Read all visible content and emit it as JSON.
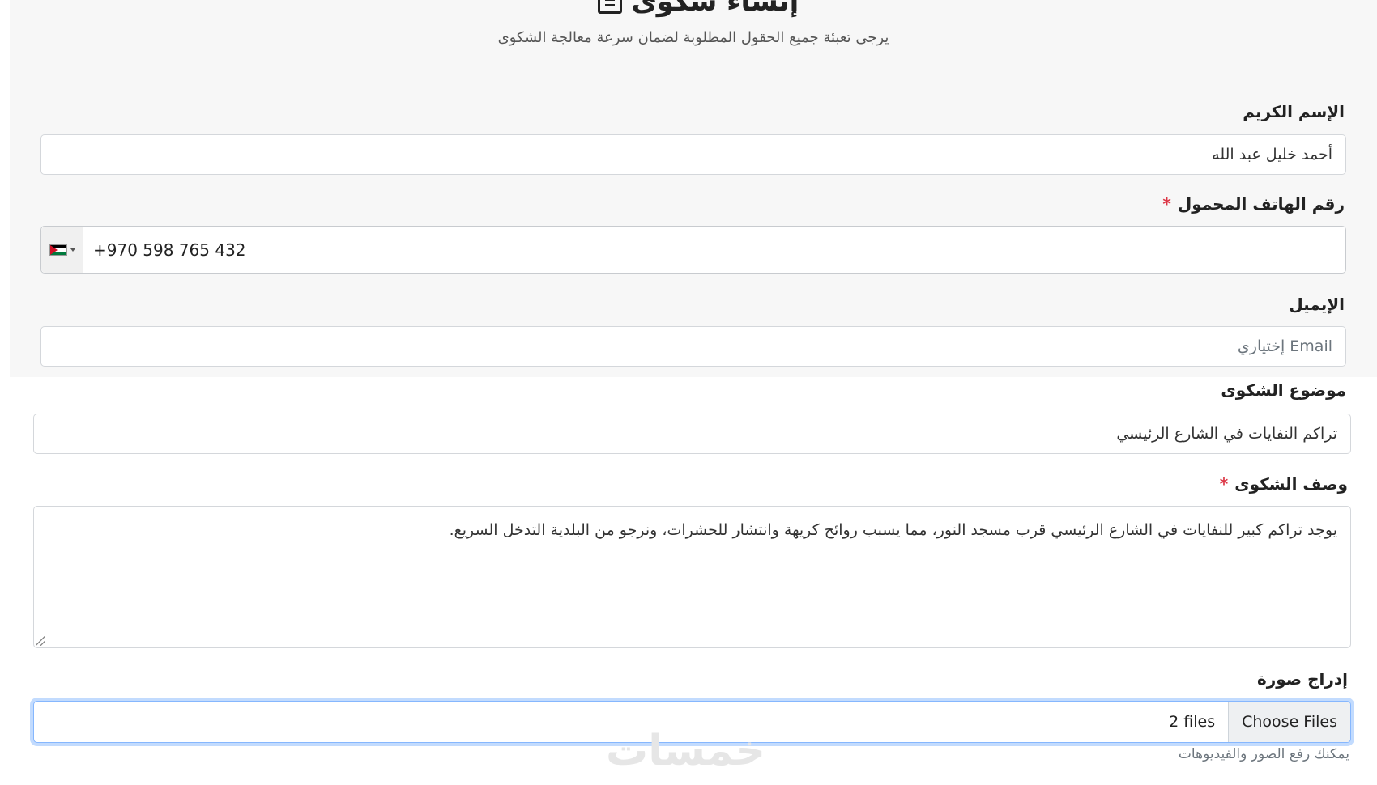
{
  "header": {
    "title": "إنشاء شكوى",
    "subtitle": "يرجى تعبئة جميع الحقول المطلوبة لضمان سرعة معالجة الشكوى"
  },
  "form": {
    "name": {
      "label": "الإسم الكريم",
      "value": "أحمد خليل عبد الله"
    },
    "phone": {
      "label": "رقم الهاتف المحمول",
      "required_mark": "*",
      "value": "+970 598 765 432",
      "country_flag": "palestine-flag-icon"
    },
    "email": {
      "label": "الإيميل",
      "placeholder": "Email إختياري"
    },
    "subject": {
      "label": "موضوع الشكوى",
      "value": "تراكم النفايات في الشارع الرئيسي"
    },
    "description": {
      "label": "وصف الشكوى",
      "required_mark": "*",
      "value": "يوجد تراكم كبير للنفايات في الشارع الرئيسي قرب مسجد النور، مما يسبب روائح كريهة وانتشار للحشرات، ونرجو من البلدية التدخل السريع."
    },
    "image": {
      "label": "إدراج صورة",
      "button_label": "Choose Files",
      "file_status": "2 files",
      "hint": "يمكنك رفع الصور والفيديوهات"
    }
  },
  "watermark": "خمسات",
  "colors": {
    "required": "#dc3545",
    "focus_border": "#86b7fe",
    "page_bg": "#f7f7f7"
  }
}
